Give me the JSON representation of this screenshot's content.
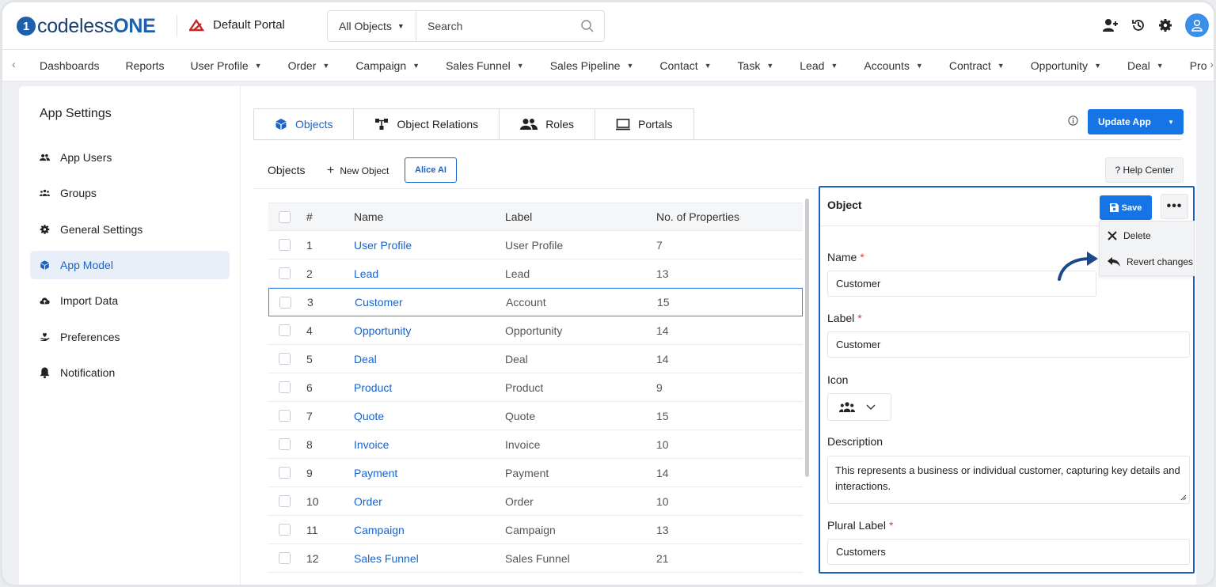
{
  "header": {
    "logo_prefix": "codeless",
    "logo_suffix": "ONE",
    "portal_name": "Default Portal",
    "search_scope": "All Objects",
    "search_placeholder": "Search"
  },
  "nav": {
    "items": [
      {
        "label": "Dashboards",
        "dropdown": false
      },
      {
        "label": "Reports",
        "dropdown": false
      },
      {
        "label": "User Profile",
        "dropdown": true
      },
      {
        "label": "Order",
        "dropdown": true
      },
      {
        "label": "Campaign",
        "dropdown": true
      },
      {
        "label": "Sales Funnel",
        "dropdown": true
      },
      {
        "label": "Sales Pipeline",
        "dropdown": true
      },
      {
        "label": "Contact",
        "dropdown": true
      },
      {
        "label": "Task",
        "dropdown": true
      },
      {
        "label": "Lead",
        "dropdown": true
      },
      {
        "label": "Accounts",
        "dropdown": true
      },
      {
        "label": "Contract",
        "dropdown": true
      },
      {
        "label": "Opportunity",
        "dropdown": true
      },
      {
        "label": "Deal",
        "dropdown": true
      },
      {
        "label": "Pro",
        "dropdown": false
      }
    ]
  },
  "sidebar": {
    "title": "App Settings",
    "items": [
      {
        "label": "App Users",
        "icon": "users-icon",
        "active": false
      },
      {
        "label": "Groups",
        "icon": "group-icon",
        "active": false
      },
      {
        "label": "General Settings",
        "icon": "gear-icon",
        "active": false
      },
      {
        "label": "App Model",
        "icon": "cube-icon",
        "active": true
      },
      {
        "label": "Import Data",
        "icon": "cloud-upload-icon",
        "active": false
      },
      {
        "label": "Preferences",
        "icon": "hand-heart-icon",
        "active": false
      },
      {
        "label": "Notification",
        "icon": "bell-icon",
        "active": false
      }
    ]
  },
  "tabs": [
    {
      "label": "Objects",
      "icon": "cube-icon",
      "active": true
    },
    {
      "label": "Object Relations",
      "icon": "relations-icon",
      "active": false
    },
    {
      "label": "Roles",
      "icon": "roles-icon",
      "active": false
    },
    {
      "label": "Portals",
      "icon": "monitor-icon",
      "active": false
    }
  ],
  "toolbar": {
    "update_label": "Update App",
    "objects_label": "Objects",
    "new_object_label": "New Object",
    "alice_label": "Alice AI",
    "help_label": "? Help Center"
  },
  "table": {
    "columns": [
      "#",
      "Name",
      "Label",
      "No. of Properties"
    ],
    "rows": [
      {
        "num": "1",
        "name": "User Profile",
        "label": "User Profile",
        "props": "7"
      },
      {
        "num": "2",
        "name": "Lead",
        "label": "Lead",
        "props": "13"
      },
      {
        "num": "3",
        "name": "Customer",
        "label": "Account",
        "props": "15"
      },
      {
        "num": "4",
        "name": "Opportunity",
        "label": "Opportunity",
        "props": "14"
      },
      {
        "num": "5",
        "name": "Deal",
        "label": "Deal",
        "props": "14"
      },
      {
        "num": "6",
        "name": "Product",
        "label": "Product",
        "props": "9"
      },
      {
        "num": "7",
        "name": "Quote",
        "label": "Quote",
        "props": "15"
      },
      {
        "num": "8",
        "name": "Invoice",
        "label": "Invoice",
        "props": "10"
      },
      {
        "num": "9",
        "name": "Payment",
        "label": "Payment",
        "props": "14"
      },
      {
        "num": "10",
        "name": "Order",
        "label": "Order",
        "props": "10"
      },
      {
        "num": "11",
        "name": "Campaign",
        "label": "Campaign",
        "props": "13"
      },
      {
        "num": "12",
        "name": "Sales Funnel",
        "label": "Sales Funnel",
        "props": "21"
      }
    ]
  },
  "panel": {
    "title": "Object",
    "save_label": "Save",
    "menu": {
      "delete_label": "Delete",
      "revert_label": "Revert changes"
    },
    "name_label": "Name",
    "name_value": "Customer",
    "label_label": "Label",
    "label_value": "Customer",
    "icon_label": "Icon",
    "description_label": "Description",
    "description_value": "This represents a business or individual customer, capturing key details and interactions.",
    "plural_label": "Plural Label",
    "plural_value": "Customers",
    "required_mark": "*"
  },
  "colors": {
    "accent": "#1574e6",
    "link": "#1a63c7",
    "required": "#e03a3a",
    "logo": "#1c3f73"
  }
}
